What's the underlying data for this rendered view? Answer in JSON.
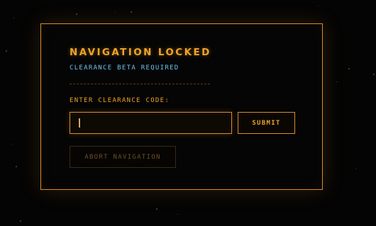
{
  "dialog": {
    "title": "NAVIGATION LOCKED",
    "subtitle": "CLEARANCE BETA REQUIRED",
    "field_label": "ENTER CLEARANCE CODE:",
    "code_value": "",
    "submit_label": "SUBMIT",
    "abort_label": "ABORT NAVIGATION"
  },
  "colors": {
    "accent": "#f0a326",
    "border": "#d98a2b",
    "subtitle": "#6ec3e6",
    "disabled_text": "#6e4f22",
    "background": "#040404"
  }
}
